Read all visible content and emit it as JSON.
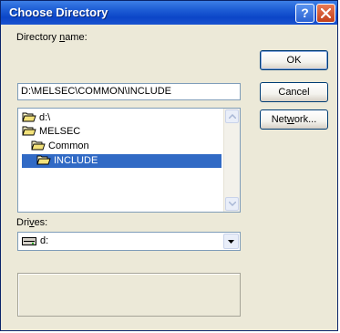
{
  "window": {
    "title": "Choose Directory",
    "help_glyph": "?"
  },
  "directory": {
    "label_pre": "Directory ",
    "label_mnemonic": "n",
    "label_post": "ame:",
    "value": "D:\\MELSEC\\COMMON\\INCLUDE"
  },
  "tree": {
    "items": [
      {
        "label": "d:\\",
        "icon": "open-folder-icon",
        "selected": false
      },
      {
        "label": "MELSEC",
        "icon": "open-folder-icon",
        "selected": false
      },
      {
        "label": "Common",
        "icon": "open-folder-icon",
        "selected": false
      },
      {
        "label": "INCLUDE",
        "icon": "open-folder-icon",
        "selected": true
      }
    ]
  },
  "drives": {
    "label_pre": "Dri",
    "label_mnemonic": "v",
    "label_post": "es:",
    "value": "d:",
    "icon": "drive-icon"
  },
  "buttons": {
    "ok": "OK",
    "cancel": "Cancel",
    "network_pre": "Net",
    "network_mnemonic": "w",
    "network_post": "ork..."
  },
  "colors": {
    "title_bar": "#0b45c8",
    "selection": "#316ac5",
    "dialog_bg": "#ece9d8"
  }
}
